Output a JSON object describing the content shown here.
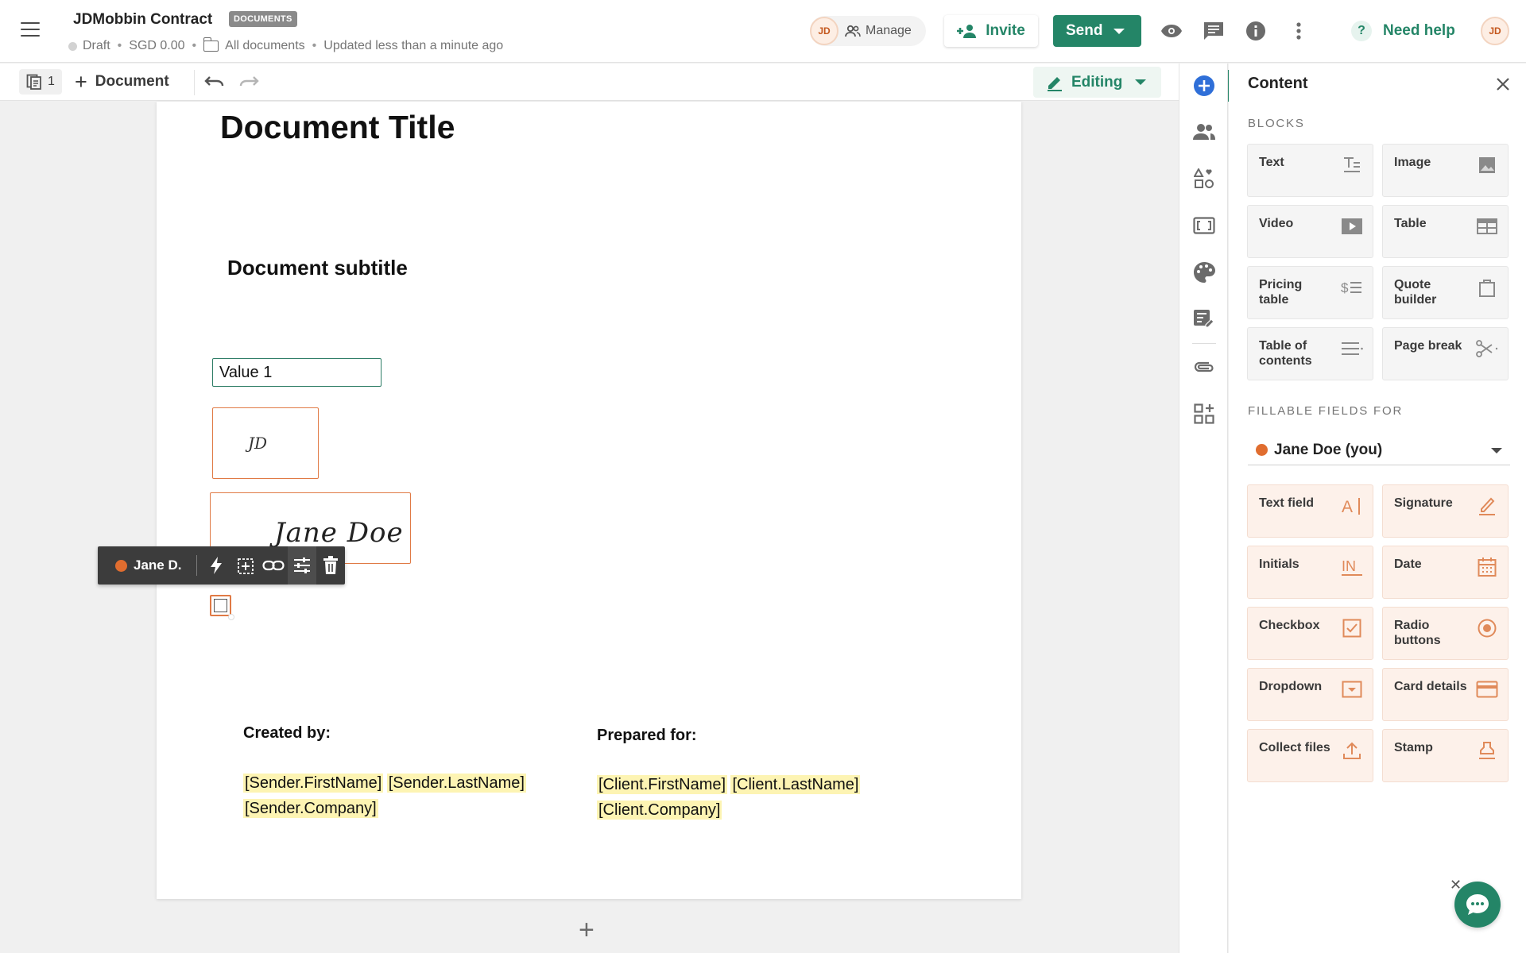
{
  "header": {
    "doc_name": "JDMobbin Contract",
    "badge": "DOCUMENTS",
    "status": "Draft",
    "amount": "SGD 0.00",
    "folder": "All documents",
    "updated": "Updated less than a minute ago",
    "avatar_initials": "JD",
    "manage_label": "Manage",
    "invite_label": "Invite",
    "send_label": "Send",
    "help_label": "Need help"
  },
  "toolbar": {
    "page_count": "1",
    "add_document_label": "Document",
    "mode_label": "Editing"
  },
  "document": {
    "title": "Document Title",
    "subtitle": "Document subtitle",
    "text_field_value": "Value 1",
    "initials_value": "JD",
    "signature_value": "Jane Doe",
    "field_owner": "Jane D.",
    "created_by_label": "Created by:",
    "prepared_for_label": "Prepared for:",
    "sender_tokens": [
      "[Sender.FirstName]",
      "[Sender.LastName]",
      "[Sender.Company]"
    ],
    "client_tokens": [
      "[Client.FirstName]",
      "[Client.LastName]",
      "[Client.Company]"
    ],
    "add_block_symbol": "+"
  },
  "panel": {
    "title": "Content",
    "blocks_label": "BLOCKS",
    "blocks": [
      {
        "label": "Text",
        "icon": "text-block-icon"
      },
      {
        "label": "Image",
        "icon": "image-block-icon"
      },
      {
        "label": "Video",
        "icon": "video-block-icon"
      },
      {
        "label": "Table",
        "icon": "table-block-icon"
      },
      {
        "label": "Pricing table",
        "icon": "pricing-table-icon"
      },
      {
        "label": "Quote builder",
        "icon": "quote-builder-icon"
      },
      {
        "label": "Table of contents",
        "icon": "toc-icon"
      },
      {
        "label": "Page break",
        "icon": "scissors-icon"
      }
    ],
    "fillable_label": "FILLABLE FIELDS FOR",
    "recipient": "Jane Doe (you)",
    "fields": [
      {
        "label": "Text field",
        "icon": "text-field-icon"
      },
      {
        "label": "Signature",
        "icon": "pen-icon"
      },
      {
        "label": "Initials",
        "icon": "initials-icon"
      },
      {
        "label": "Date",
        "icon": "calendar-icon"
      },
      {
        "label": "Checkbox",
        "icon": "checkbox-icon"
      },
      {
        "label": "Radio buttons",
        "icon": "radio-icon"
      },
      {
        "label": "Dropdown",
        "icon": "dropdown-icon"
      },
      {
        "label": "Card details",
        "icon": "card-icon"
      },
      {
        "label": "Collect files",
        "icon": "upload-icon"
      },
      {
        "label": "Stamp",
        "icon": "stamp-icon"
      }
    ]
  },
  "colors": {
    "brand_green": "#248567",
    "field_orange": "#e07a45",
    "token_yellow": "#fdf4b3"
  }
}
